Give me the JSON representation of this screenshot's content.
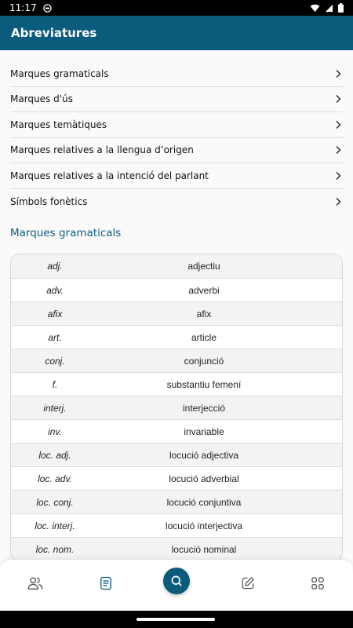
{
  "status_bar": {
    "time": "11:17"
  },
  "app_bar": {
    "title": "Abreviatures"
  },
  "menu": {
    "items": [
      {
        "label": "Marques gramaticals"
      },
      {
        "label": "Marques d'ús"
      },
      {
        "label": "Marques temàtiques"
      },
      {
        "label": "Marques relatives a la llengua d’origen"
      },
      {
        "label": "Marques relatives a la intenció del parlant"
      },
      {
        "label": "Símbols fonètics"
      }
    ]
  },
  "section": {
    "title": "Marques gramaticals"
  },
  "table": {
    "rows": [
      {
        "abbr": "adj.",
        "meaning": "adjectiu"
      },
      {
        "abbr": "adv.",
        "meaning": "adverbi"
      },
      {
        "abbr": "afix",
        "meaning": "afix"
      },
      {
        "abbr": "art.",
        "meaning": "article"
      },
      {
        "abbr": "conj.",
        "meaning": "conjunció"
      },
      {
        "abbr": "f.",
        "meaning": "substantiu femení"
      },
      {
        "abbr": "interj.",
        "meaning": "interjecció"
      },
      {
        "abbr": "inv.",
        "meaning": "invariable"
      },
      {
        "abbr": "loc. adj.",
        "meaning": "locució adjectiva"
      },
      {
        "abbr": "loc. adv.",
        "meaning": "locució adverbial"
      },
      {
        "abbr": "loc. conj.",
        "meaning": "locució conjuntiva"
      },
      {
        "abbr": "loc. interj.",
        "meaning": "locució interjectiva"
      },
      {
        "abbr": "loc. nom.",
        "meaning": "locució nominal"
      }
    ]
  },
  "bottom_nav": {
    "items": [
      {
        "icon": "users-icon"
      },
      {
        "icon": "list-document-icon"
      },
      {
        "icon": "search-icon"
      },
      {
        "icon": "edit-icon"
      },
      {
        "icon": "grid-icon"
      }
    ]
  },
  "colors": {
    "primary": "#0b5b7d",
    "background": "#fafafa",
    "row_alt": "#f3f3f3"
  }
}
